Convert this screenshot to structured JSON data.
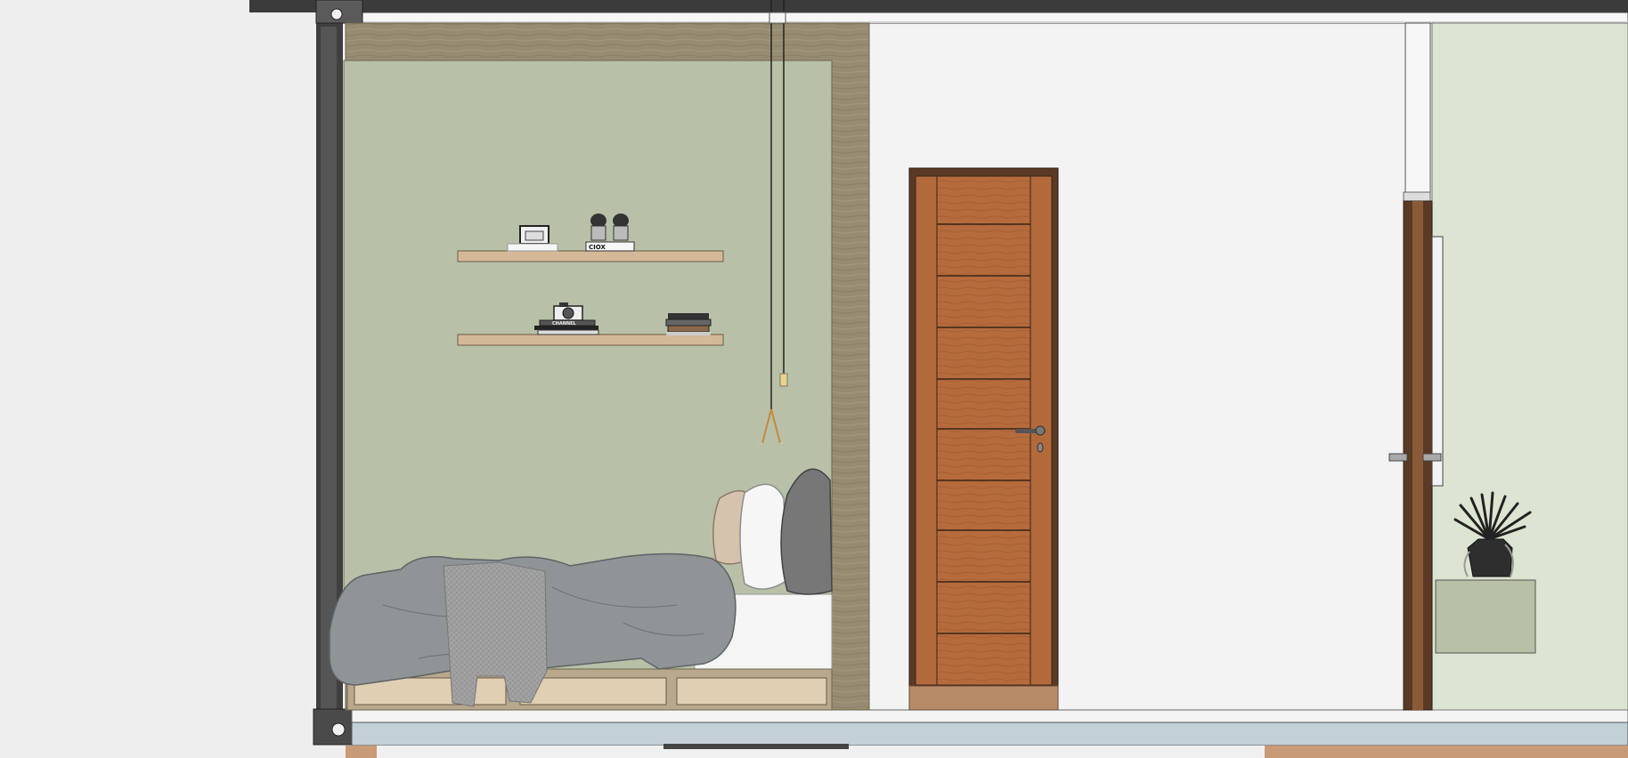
{
  "drawing": {
    "view": "section-elevation",
    "colors": {
      "background": "#eeeeee",
      "room_wall": "#f3f3f3",
      "niche_wall": "#b8c0a8",
      "adjacent_wall": "#dce4d2",
      "wood_frame": "#978c72",
      "shelf": "#d4b999",
      "door_panel": "#b56b3c",
      "door_frame": "#5a3a26",
      "bedding": "#8f9496",
      "slab": "#c4d0d8",
      "column": "#3f3f3f"
    },
    "shelf_items": {
      "upper_book_label": "CIOX",
      "lower_book_label": "CHANNEL"
    },
    "icons": {
      "door_handle": "lever-handle-icon",
      "pendant": "pendant-lamp-icon",
      "plant": "plant-icon",
      "camera": "camera-icon"
    }
  }
}
